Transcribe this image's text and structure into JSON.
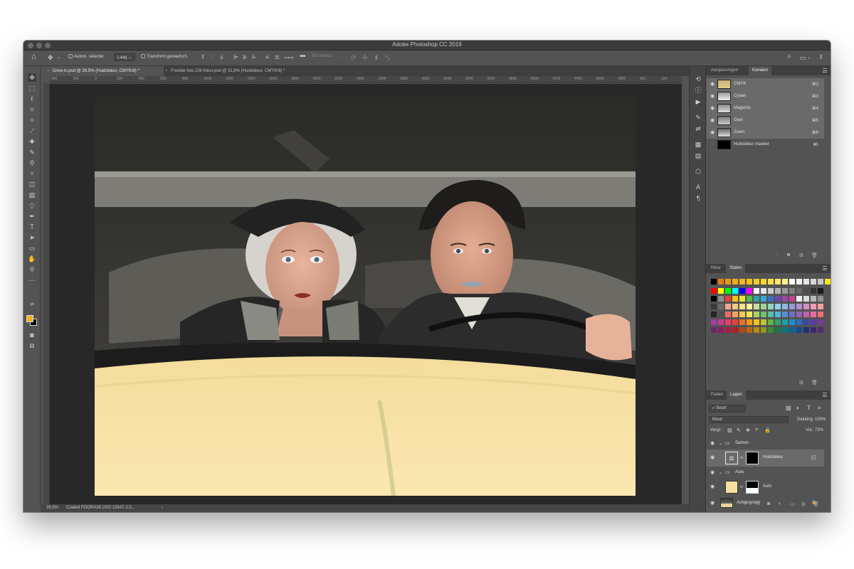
{
  "window": {
    "title": "Adobe Photoshop CC 2019"
  },
  "options_bar": {
    "auto_select_label": "Autom. selectie:",
    "layer_select": "Laag",
    "transform_label": "Transform.gereedsch.",
    "mode_3d_label": "3D-modus:"
  },
  "document_tabs": [
    {
      "label": "Drive-in.psd @ 26,5% (Huidskleur, CMYK/8) *"
    },
    {
      "label": "Freebie-foto-ZW-Kleur.psd @ 31,8% (Huidskleur, CMYK/8) *"
    }
  ],
  "ruler": {
    "horizontal_ticks": [
      "400",
      "200",
      "0",
      "200",
      "400",
      "600",
      "800",
      "1000",
      "1200",
      "1400",
      "1600",
      "1800",
      "2000",
      "2200",
      "2400",
      "2600",
      "2800",
      "3000",
      "3200",
      "3400",
      "3600",
      "3800",
      "4000",
      "4200",
      "4400",
      "4600",
      "4800",
      "500",
      "520"
    ]
  },
  "status_bar": {
    "zoom": "26,5%",
    "profile": "Coated FOGRA39 (ISO 12647-2:2..."
  },
  "channels_panel": {
    "tabs": [
      "Aanpassingen",
      "Kanalen"
    ],
    "active_tab": "Kanalen",
    "channels": [
      {
        "name": "CMYK",
        "shortcut": "⌘2"
      },
      {
        "name": "Cyaan",
        "shortcut": "⌘3"
      },
      {
        "name": "Magenta",
        "shortcut": "⌘4"
      },
      {
        "name": "Geel",
        "shortcut": "⌘5"
      },
      {
        "name": "Zwart",
        "shortcut": "⌘6"
      },
      {
        "name": "Huidskleur masker",
        "shortcut": "⌘\\"
      }
    ]
  },
  "swatches_panel": {
    "tabs": [
      "Kleur",
      "Stalen"
    ],
    "active_tab": "Stalen",
    "top_row": [
      "#000000",
      "#e87a1a",
      "#e89a1a",
      "#efa91a",
      "#f2b51c",
      "#f4c21f",
      "#f5cc25",
      "#f7d633",
      "#f9df4a",
      "#fbe866",
      "#fdf08a",
      "#ffffff",
      "#f2f2f2",
      "#e4e4e4",
      "#d6d6d6",
      "#c8c8c8",
      "#f5e61e",
      "#ffffff"
    ],
    "rows": [
      [
        "#ff0000",
        "#ffff00",
        "#00ff00",
        "#00ffff",
        "#0000ff",
        "#ff00ff",
        "#ffffff",
        "#e6e6e6",
        "#cccccc",
        "#b3b3b3",
        "#999999",
        "#808080",
        "#666666",
        "#4d4d4d",
        "#333333",
        "#1a1a1a"
      ],
      [
        "#000000",
        "#8c8c8c",
        "#e8403a",
        "#f3c21a",
        "#e6e63a",
        "#55b848",
        "#2fa7a0",
        "#3ea3d8",
        "#3a6fc0",
        "#6a4aa8",
        "#9a4aa0",
        "#c8408a",
        "#f0f0f0",
        "#dcdcdc",
        "#b8b8b8",
        "#909090"
      ],
      [
        "#3a3a3a",
        "#6a6a6a",
        "#f4a88c",
        "#f8c88a",
        "#fae28a",
        "#fff39a",
        "#c8e29a",
        "#9fd49a",
        "#92d2c4",
        "#8fd2ea",
        "#8fb6e2",
        "#9a9ad6",
        "#b48fce",
        "#d291c6",
        "#f09ab8",
        "#f2a0a0"
      ],
      [
        "#262626",
        "#505050",
        "#ee6c5c",
        "#f4a460",
        "#f8cc50",
        "#fbeb5a",
        "#a8d468",
        "#6cc26a",
        "#58bfa8",
        "#4cb8e0",
        "#5a8ed4",
        "#7070c4",
        "#9464b8",
        "#c064b0",
        "#e86ca0",
        "#ec7070"
      ],
      [
        "#a040a0",
        "#c83c8c",
        "#e83c6a",
        "#e8403a",
        "#ec6e2a",
        "#f29a1e",
        "#f4c21a",
        "#b8c83a",
        "#64b448",
        "#2ca470",
        "#1ea0a8",
        "#1e8cd0",
        "#2a6cc0",
        "#3a4aa8",
        "#5a3c9c",
        "#7a3a9a"
      ],
      [
        "#6a2a6a",
        "#8c1e5e",
        "#a81e40",
        "#b01e1e",
        "#b4461a",
        "#b86a12",
        "#b88c12",
        "#8c9a26",
        "#3e8a34",
        "#147a52",
        "#0c7880",
        "#0a6498",
        "#164a8c",
        "#203078",
        "#3a2870",
        "#542870"
      ]
    ]
  },
  "layers_panel": {
    "tabs": [
      "Paden",
      "Lagen"
    ],
    "active_tab": "Lagen",
    "filter_label": "Soort",
    "blend_mode": "Kleur",
    "opacity_label": "Dekking:",
    "opacity_value": "100%",
    "lock_label": "Vergr.:",
    "fill_label": "Vul:",
    "fill_value": "73%",
    "layers": [
      {
        "name": "Samen",
        "type": "group"
      },
      {
        "name": "Huidskleur",
        "type": "adjustment",
        "selected": true
      },
      {
        "name": "Auto",
        "type": "group"
      },
      {
        "name": "Auto",
        "type": "fill"
      },
      {
        "name": "Achtergrond",
        "type": "background"
      }
    ]
  },
  "colors": {
    "foreground": "#f2b21c",
    "background": "#000000",
    "car_yellow": "#f6dfa0",
    "ui_dark": "#535353",
    "ui_darker": "#3e3e3e"
  },
  "icons": {
    "tools": [
      "move-icon",
      "marquee-icon",
      "lasso-icon",
      "crop-icon",
      "magic-wand-icon",
      "eyedropper-icon",
      "healing-brush-icon",
      "brush-icon",
      "clone-stamp-icon",
      "history-brush-icon",
      "eraser-icon",
      "gradient-icon",
      "dodge-icon",
      "pen-icon",
      "type-icon",
      "path-selection-icon",
      "shape-icon",
      "hand-icon",
      "zoom-icon",
      "more-tools-icon",
      "quick-mask-icon",
      "screen-mode-icon"
    ]
  }
}
